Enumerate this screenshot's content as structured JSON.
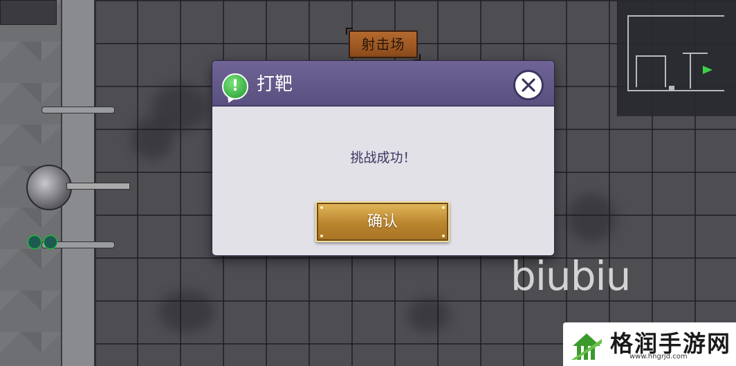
{
  "location_tag": "射击场",
  "dialog": {
    "title": "打靶",
    "message": "挑战成功！",
    "confirm_label": "确认"
  },
  "icons": {
    "header_icon": "exclamation-speech-bubble-icon",
    "close_icon": "close-x-icon"
  },
  "watermark": {
    "text": "biubiu",
    "site_name": "格润手游网",
    "site_url": "www.hngrjd.com"
  },
  "colors": {
    "dialog_header": "#5f5587",
    "dialog_body": "#e3e1e8",
    "confirm_button": "#c8963a",
    "location_tag": "#a45b24",
    "minimap_player": "#3bd24a"
  }
}
